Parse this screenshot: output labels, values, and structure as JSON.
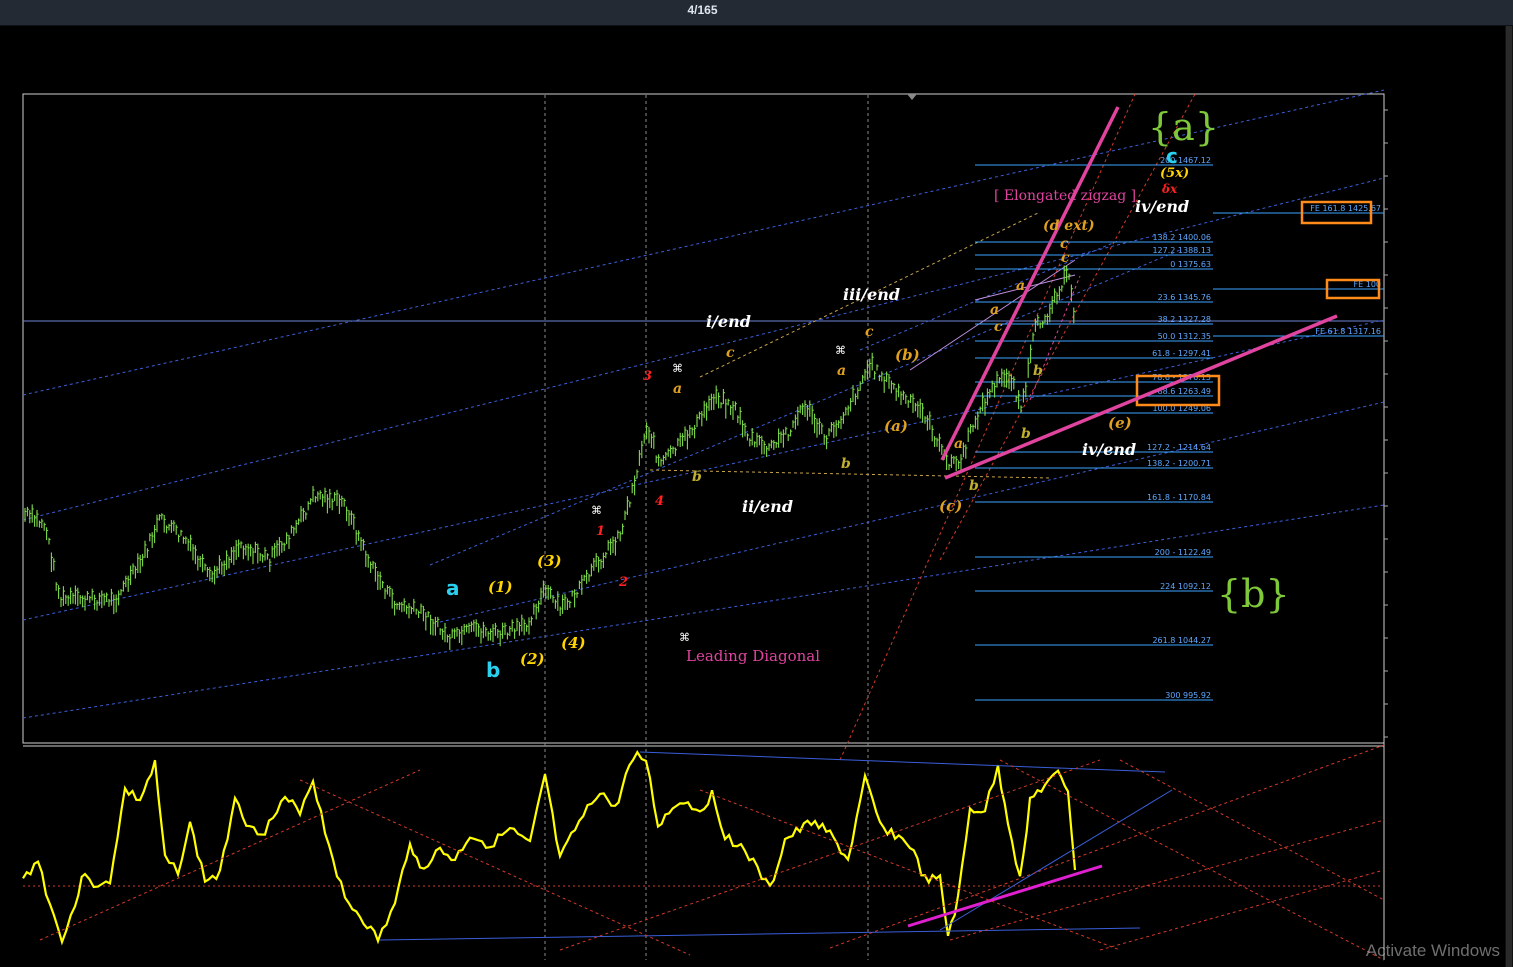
{
  "app": {
    "page_counter": "4/165",
    "watermark": "Activate Windows"
  },
  "colors": {
    "background": "#000000",
    "price_bar": "#7fdc4c",
    "oscillator": "#ffff00",
    "trendline": "#e0449f",
    "channel_blue": "#3a5fd9",
    "fib_line": "#3ba3ff",
    "fib_label": "#5fa8ff",
    "orange_box": "#ff8c1a",
    "red_dash": "#d23a2a"
  },
  "chart_data": {
    "type": "line",
    "title": "",
    "price_pane": {
      "fib_levels": [
        {
          "label": "200 1467.12",
          "value": 1467.12
        },
        {
          "label": "FE 161.8 1425.67",
          "value": 1425.67
        },
        {
          "label": "138.2 1400.06",
          "value": 1400.06
        },
        {
          "label": "127.2 1388.13",
          "value": 1388.13
        },
        {
          "label": "0 1375.63",
          "value": 1375.63
        },
        {
          "label": "FE 100",
          "value": 1360
        },
        {
          "label": "23.6 1345.76",
          "value": 1345.76
        },
        {
          "label": "38.2 1327.28",
          "value": 1327.28
        },
        {
          "label": "FE 61.8 1317.16",
          "value": 1317.16
        },
        {
          "label": "50.0 1312.35",
          "value": 1312.35
        },
        {
          "label": "61.8 - 1297.41",
          "value": 1297.41
        },
        {
          "label": "78.6 - 1276.15",
          "value": 1276.15
        },
        {
          "label": "88.6 1263.49",
          "value": 1263.49
        },
        {
          "label": "100.0 1249.06",
          "value": 1249.06
        },
        {
          "label": "127.2 - 1214.64",
          "value": 1214.64
        },
        {
          "label": "138.2 - 1200.71",
          "value": 1200.71
        },
        {
          "label": "161.8 - 1170.84",
          "value": 1170.84
        },
        {
          "label": "200 - 1122.49",
          "value": 1122.49
        },
        {
          "label": "224 1092.12",
          "value": 1092.12
        },
        {
          "label": "261.8 1044.27",
          "value": 1044.27
        },
        {
          "label": "300 995.92",
          "value": 995.92
        }
      ],
      "highlighted_levels": [
        "FE 161.8 1425.67",
        "FE 100",
        "78.6 - 1276.15",
        "88.6 1263.49"
      ],
      "annotations": {
        "a_big": "{a}",
        "b_big": "{b}",
        "c_top": "c",
        "five_x": "(5x)",
        "delta_x": "δx",
        "elongated": "[ Elongated zigzag ]",
        "d_ext": "(d ext)",
        "iv_end_top": "iv/end",
        "i_end": "i/end",
        "ii_end": "ii/end",
        "iii_end": "iii/end",
        "iv_end_low": "iv/end",
        "leading_diagonal": "Leading Diagonal",
        "a_cyan": "a",
        "b_cyan": "b",
        "w1": "(1)",
        "w2": "(2)",
        "w3": "(3)",
        "w4": "(4)",
        "pa": "(a)",
        "pb": "(b)",
        "pc": "(c)",
        "pe": "(e)",
        "r1": "1",
        "r2": "2",
        "r3": "3",
        "r4": "4",
        "sa": "a",
        "sb": "b",
        "sc": "c",
        "cmd": "⌘"
      }
    },
    "oscillator_pane": {
      "name": "",
      "series_color": "#ffff00"
    },
    "grid": false
  }
}
